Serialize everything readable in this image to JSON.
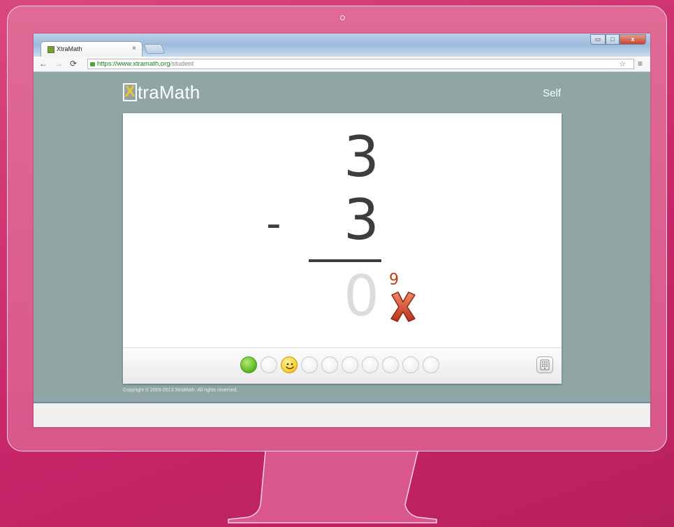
{
  "browser": {
    "tab_title": "XtraMath",
    "tab_close": "×",
    "url_host": "https://www.xtramath.org",
    "url_path": "/student",
    "window_controls": {
      "minimize": "▭",
      "maximize": "□",
      "close": "x"
    }
  },
  "app": {
    "logo_x": "X",
    "logo_text": "traMath",
    "user_name": "Self"
  },
  "problem": {
    "top_number": "3",
    "operator": "-",
    "bottom_number": "3",
    "entered_answer": "0",
    "correct_answer": "9",
    "result": "wrong"
  },
  "progress": {
    "states": [
      "green",
      "empty",
      "smile",
      "empty",
      "empty",
      "empty",
      "empty",
      "empty",
      "empty",
      "empty"
    ]
  },
  "footer": {
    "copyright": "Copyright © 2009-2013 XtraMath. All rights reserved."
  },
  "colors": {
    "background": "#c8276a",
    "page_bg": "#8fa6a5",
    "wrong_mark": "#c0391b",
    "logo_accent": "#f1c232"
  }
}
